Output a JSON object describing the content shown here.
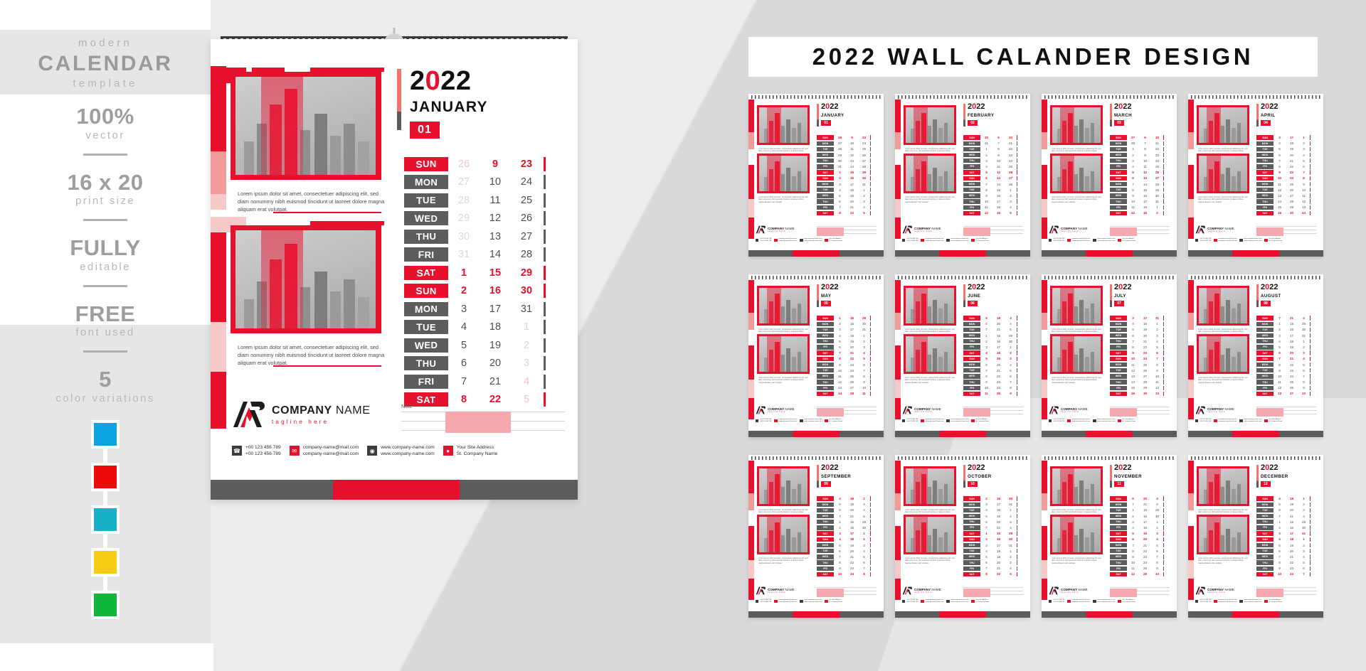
{
  "sidebar": {
    "modern": "modern",
    "calendar": "CALENDAR",
    "template": "template",
    "features": [
      {
        "big": "100%",
        "sub": "vector"
      },
      {
        "big": "16 x 20",
        "sub": "print size"
      },
      {
        "big": "FULLY",
        "sub": "editable"
      },
      {
        "big": "FREE",
        "sub": "font used"
      },
      {
        "big": "5",
        "sub": "color variations"
      }
    ],
    "swatches": [
      "#0ba3e0",
      "#ef0a0a",
      "#17b0c4",
      "#f8cc16",
      "#10b53c"
    ]
  },
  "main_page": {
    "year": "2022",
    "year_pre": "2",
    "year_zero": "0",
    "year_post": "22",
    "month": "JANUARY",
    "month_number": "01",
    "lorem": "Lorem ipsum dolor sit amet, consectetuer adipiscing elit, sed diam nonummy nibh euismod tincidunt ut laoreet dolore magna aliquam erat volutpat.",
    "note_label": "Note",
    "company_name_bold": "COMPANY",
    "company_name_light": "NAME",
    "tagline": "tagline here",
    "contacts": [
      {
        "icon": "phone-icon",
        "glyph": "☎",
        "line1": "+00 123 456 789",
        "line2": "+00 123 456 789",
        "color": "dark"
      },
      {
        "icon": "envelope-icon",
        "glyph": "✉",
        "line1": "company-name@mail.com",
        "line2": "company-name@mail.com",
        "color": "red"
      },
      {
        "icon": "globe-icon",
        "glyph": "◉",
        "line1": "www.company-name.com",
        "line2": "www.company-name.com",
        "color": "dark"
      },
      {
        "icon": "location-pin-icon",
        "glyph": "●",
        "line1": "Your Site Address",
        "line2": "St. Company Name",
        "color": "red"
      }
    ],
    "days": [
      {
        "day": "SUN",
        "weekend": true,
        "n1": "26",
        "s1": "mutedred",
        "n2": "9",
        "s2": "red",
        "n3": "23",
        "s3": "red"
      },
      {
        "day": "MON",
        "weekend": false,
        "n1": "27",
        "s1": "muted",
        "n2": "10",
        "s2": "dark",
        "n3": "24",
        "s3": "dark"
      },
      {
        "day": "TUE",
        "weekend": false,
        "n1": "28",
        "s1": "muted",
        "n2": "11",
        "s2": "dark",
        "n3": "25",
        "s3": "dark"
      },
      {
        "day": "WED",
        "weekend": false,
        "n1": "29",
        "s1": "muted",
        "n2": "12",
        "s2": "dark",
        "n3": "26",
        "s3": "dark"
      },
      {
        "day": "THU",
        "weekend": false,
        "n1": "30",
        "s1": "muted",
        "n2": "13",
        "s2": "dark",
        "n3": "27",
        "s3": "dark"
      },
      {
        "day": "FRI",
        "weekend": false,
        "n1": "31",
        "s1": "muted",
        "n2": "14",
        "s2": "dark",
        "n3": "28",
        "s3": "dark"
      },
      {
        "day": "SAT",
        "weekend": true,
        "n1": "1",
        "s1": "red",
        "n2": "15",
        "s2": "red",
        "n3": "29",
        "s3": "red"
      },
      {
        "day": "SUN",
        "weekend": true,
        "n1": "2",
        "s1": "red",
        "n2": "16",
        "s2": "red",
        "n3": "30",
        "s3": "red"
      },
      {
        "day": "MON",
        "weekend": false,
        "n1": "3",
        "s1": "dark",
        "n2": "17",
        "s2": "dark",
        "n3": "31",
        "s3": "dark"
      },
      {
        "day": "TUE",
        "weekend": false,
        "n1": "4",
        "s1": "dark",
        "n2": "18",
        "s2": "dark",
        "n3": "1",
        "s3": "muted"
      },
      {
        "day": "WED",
        "weekend": false,
        "n1": "5",
        "s1": "dark",
        "n2": "19",
        "s2": "dark",
        "n3": "2",
        "s3": "muted"
      },
      {
        "day": "THU",
        "weekend": false,
        "n1": "6",
        "s1": "dark",
        "n2": "20",
        "s2": "dark",
        "n3": "3",
        "s3": "muted"
      },
      {
        "day": "FRI",
        "weekend": false,
        "n1": "7",
        "s1": "dark",
        "n2": "21",
        "s2": "dark",
        "n3": "4",
        "s3": "mutedred"
      },
      {
        "day": "SAT",
        "weekend": true,
        "n1": "8",
        "s1": "red",
        "n2": "22",
        "s2": "red",
        "n3": "5",
        "s3": "mutedred"
      }
    ]
  },
  "right_panel": {
    "title": "2022 WALL CALANDER DESIGN",
    "months": [
      {
        "year": "2022",
        "name": "JANUARY",
        "num": "01"
      },
      {
        "year": "2022",
        "name": "FEBRUARY",
        "num": "02"
      },
      {
        "year": "2022",
        "name": "MARCH",
        "num": "03"
      },
      {
        "year": "2022",
        "name": "APRIL",
        "num": "04"
      },
      {
        "year": "2022",
        "name": "MAY",
        "num": "05"
      },
      {
        "year": "2022",
        "name": "JUNE",
        "num": "06"
      },
      {
        "year": "2022",
        "name": "JULY",
        "num": "07"
      },
      {
        "year": "2022",
        "name": "AUGUST",
        "num": "08"
      },
      {
        "year": "2022",
        "name": "SEPTEMBER",
        "num": "09"
      },
      {
        "year": "2022",
        "name": "OCTOBER",
        "num": "10"
      },
      {
        "year": "2022",
        "name": "NOVEMBER",
        "num": "11"
      },
      {
        "year": "2022",
        "name": "DECEMBER",
        "num": "12"
      }
    ],
    "thumb_days": [
      "SUN",
      "MON",
      "TUE",
      "WED",
      "THU",
      "FRI",
      "SAT",
      "SUN",
      "MON",
      "TUE",
      "WED",
      "THU",
      "FRI",
      "SAT"
    ],
    "thumb_company": "COMPANY NAME",
    "thumb_tagline": "tagline here",
    "thumb_cols": {
      "01": [
        [
          "26",
          "9",
          "23"
        ],
        [
          "27",
          "10",
          "24"
        ],
        [
          "28",
          "11",
          "25"
        ],
        [
          "29",
          "12",
          "26"
        ],
        [
          "30",
          "13",
          "27"
        ],
        [
          "31",
          "14",
          "28"
        ],
        [
          "1",
          "15",
          "29"
        ],
        [
          "2",
          "16",
          "30"
        ],
        [
          "3",
          "17",
          "31"
        ],
        [
          "4",
          "18",
          "1"
        ],
        [
          "5",
          "19",
          "2"
        ],
        [
          "6",
          "20",
          "3"
        ],
        [
          "7",
          "21",
          "4"
        ],
        [
          "8",
          "22",
          "5"
        ]
      ],
      "02": [
        [
          "30",
          "6",
          "20"
        ],
        [
          "31",
          "7",
          "21"
        ],
        [
          "1",
          "8",
          "22"
        ],
        [
          "2",
          "9",
          "23"
        ],
        [
          "3",
          "10",
          "24"
        ],
        [
          "4",
          "11",
          "25"
        ],
        [
          "5",
          "12",
          "26"
        ],
        [
          "6",
          "13",
          "27"
        ],
        [
          "7",
          "14",
          "28"
        ],
        [
          "8",
          "15",
          "1"
        ],
        [
          "9",
          "16",
          "2"
        ],
        [
          "10",
          "17",
          "3"
        ],
        [
          "11",
          "18",
          "4"
        ],
        [
          "12",
          "19",
          "5"
        ]
      ],
      "03": [
        [
          "27",
          "6",
          "20"
        ],
        [
          "28",
          "7",
          "21"
        ],
        [
          "1",
          "8",
          "22"
        ],
        [
          "2",
          "9",
          "23"
        ],
        [
          "3",
          "10",
          "24"
        ],
        [
          "4",
          "11",
          "25"
        ],
        [
          "5",
          "12",
          "26"
        ],
        [
          "6",
          "13",
          "27"
        ],
        [
          "7",
          "14",
          "28"
        ],
        [
          "8",
          "15",
          "29"
        ],
        [
          "9",
          "16",
          "30"
        ],
        [
          "10",
          "17",
          "31"
        ],
        [
          "11",
          "18",
          "1"
        ],
        [
          "12",
          "19",
          "2"
        ]
      ],
      "04": [
        [
          "3",
          "17",
          "1"
        ],
        [
          "4",
          "18",
          "2"
        ],
        [
          "5",
          "19",
          "3"
        ],
        [
          "6",
          "20",
          "4"
        ],
        [
          "7",
          "21",
          "5"
        ],
        [
          "8",
          "22",
          "6"
        ],
        [
          "9",
          "23",
          "7"
        ],
        [
          "10",
          "24",
          "8"
        ],
        [
          "11",
          "25",
          "9"
        ],
        [
          "12",
          "26",
          "10"
        ],
        [
          "13",
          "27",
          "11"
        ],
        [
          "14",
          "28",
          "12"
        ],
        [
          "15",
          "29",
          "13"
        ],
        [
          "16",
          "30",
          "14"
        ]
      ],
      "05": [
        [
          "1",
          "15",
          "29"
        ],
        [
          "2",
          "16",
          "30"
        ],
        [
          "3",
          "17",
          "31"
        ],
        [
          "4",
          "18",
          "1"
        ],
        [
          "5",
          "19",
          "2"
        ],
        [
          "6",
          "20",
          "3"
        ],
        [
          "7",
          "21",
          "4"
        ],
        [
          "8",
          "22",
          "5"
        ],
        [
          "9",
          "23",
          "6"
        ],
        [
          "10",
          "24",
          "7"
        ],
        [
          "11",
          "25",
          "8"
        ],
        [
          "12",
          "26",
          "9"
        ],
        [
          "13",
          "27",
          "10"
        ],
        [
          "14",
          "28",
          "11"
        ]
      ],
      "06": [
        [
          "5",
          "19",
          "3"
        ],
        [
          "6",
          "20",
          "4"
        ],
        [
          "7",
          "21",
          "5"
        ],
        [
          "1",
          "15",
          "29"
        ],
        [
          "2",
          "16",
          "30"
        ],
        [
          "3",
          "17",
          "1"
        ],
        [
          "4",
          "18",
          "2"
        ],
        [
          "5",
          "19",
          "3"
        ],
        [
          "6",
          "20",
          "4"
        ],
        [
          "7",
          "21",
          "5"
        ],
        [
          "8",
          "22",
          "6"
        ],
        [
          "9",
          "23",
          "7"
        ],
        [
          "10",
          "24",
          "8"
        ],
        [
          "11",
          "25",
          "9"
        ]
      ],
      "07": [
        [
          "3",
          "17",
          "31"
        ],
        [
          "4",
          "18",
          "1"
        ],
        [
          "5",
          "19",
          "2"
        ],
        [
          "6",
          "20",
          "3"
        ],
        [
          "7",
          "21",
          "4"
        ],
        [
          "8",
          "22",
          "5"
        ],
        [
          "9",
          "23",
          "6"
        ],
        [
          "10",
          "24",
          "7"
        ],
        [
          "11",
          "25",
          "8"
        ],
        [
          "12",
          "26",
          "9"
        ],
        [
          "13",
          "27",
          "10"
        ],
        [
          "14",
          "28",
          "11"
        ],
        [
          "15",
          "29",
          "12"
        ],
        [
          "16",
          "30",
          "13"
        ]
      ],
      "08": [
        [
          "7",
          "21",
          "4"
        ],
        [
          "1",
          "15",
          "29"
        ],
        [
          "2",
          "16",
          "30"
        ],
        [
          "3",
          "17",
          "31"
        ],
        [
          "4",
          "18",
          "1"
        ],
        [
          "5",
          "19",
          "2"
        ],
        [
          "6",
          "20",
          "3"
        ],
        [
          "7",
          "21",
          "4"
        ],
        [
          "8",
          "22",
          "5"
        ],
        [
          "9",
          "23",
          "6"
        ],
        [
          "10",
          "24",
          "7"
        ],
        [
          "11",
          "25",
          "8"
        ],
        [
          "12",
          "26",
          "9"
        ],
        [
          "13",
          "27",
          "10"
        ]
      ],
      "09": [
        [
          "4",
          "18",
          "2"
        ],
        [
          "5",
          "19",
          "3"
        ],
        [
          "6",
          "20",
          "4"
        ],
        [
          "7",
          "21",
          "5"
        ],
        [
          "1",
          "15",
          "29"
        ],
        [
          "2",
          "16",
          "30"
        ],
        [
          "3",
          "17",
          "1"
        ],
        [
          "4",
          "18",
          "2"
        ],
        [
          "5",
          "19",
          "3"
        ],
        [
          "6",
          "20",
          "4"
        ],
        [
          "7",
          "21",
          "5"
        ],
        [
          "8",
          "22",
          "6"
        ],
        [
          "9",
          "23",
          "7"
        ],
        [
          "10",
          "24",
          "8"
        ]
      ],
      "10": [
        [
          "2",
          "16",
          "30"
        ],
        [
          "3",
          "17",
          "31"
        ],
        [
          "4",
          "18",
          "1"
        ],
        [
          "5",
          "19",
          "2"
        ],
        [
          "6",
          "20",
          "3"
        ],
        [
          "7",
          "21",
          "4"
        ],
        [
          "1",
          "15",
          "29"
        ],
        [
          "2",
          "16",
          "30"
        ],
        [
          "3",
          "17",
          "31"
        ],
        [
          "4",
          "18",
          "1"
        ],
        [
          "5",
          "19",
          "2"
        ],
        [
          "6",
          "20",
          "3"
        ],
        [
          "7",
          "21",
          "4"
        ],
        [
          "8",
          "22",
          "5"
        ]
      ],
      "11": [
        [
          "6",
          "20",
          "4"
        ],
        [
          "7",
          "21",
          "5"
        ],
        [
          "1",
          "15",
          "29"
        ],
        [
          "2",
          "16",
          "30"
        ],
        [
          "3",
          "17",
          "1"
        ],
        [
          "4",
          "18",
          "2"
        ],
        [
          "5",
          "19",
          "3"
        ],
        [
          "6",
          "20",
          "4"
        ],
        [
          "7",
          "21",
          "5"
        ],
        [
          "8",
          "22",
          "6"
        ],
        [
          "9",
          "23",
          "7"
        ],
        [
          "10",
          "24",
          "8"
        ],
        [
          "11",
          "25",
          "9"
        ],
        [
          "12",
          "26",
          "10"
        ]
      ],
      "12": [
        [
          "4",
          "18",
          "1"
        ],
        [
          "5",
          "19",
          "2"
        ],
        [
          "6",
          "20",
          "3"
        ],
        [
          "7",
          "21",
          "4"
        ],
        [
          "1",
          "15",
          "29"
        ],
        [
          "2",
          "16",
          "30"
        ],
        [
          "3",
          "17",
          "31"
        ],
        [
          "4",
          "18",
          "1"
        ],
        [
          "5",
          "19",
          "2"
        ],
        [
          "6",
          "20",
          "3"
        ],
        [
          "7",
          "21",
          "4"
        ],
        [
          "8",
          "22",
          "5"
        ],
        [
          "9",
          "23",
          "6"
        ],
        [
          "10",
          "24",
          "7"
        ]
      ]
    }
  },
  "colors": {
    "accent_red": "#e8112d",
    "dark_grey": "#5c5c5c",
    "page_bg": "#d9d9d9"
  }
}
